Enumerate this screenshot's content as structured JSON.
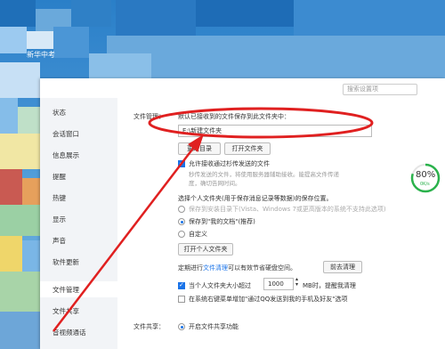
{
  "desktop": {
    "label": "新华中考"
  },
  "window": {
    "search_placeholder": "搜索设置项"
  },
  "sidebar": {
    "items": [
      {
        "label": "状态"
      },
      {
        "label": "会话窗口"
      },
      {
        "label": "信息展示"
      },
      {
        "label": "提醒"
      },
      {
        "label": "热键"
      },
      {
        "label": "显示"
      },
      {
        "label": "声音"
      },
      {
        "label": "软件更新"
      },
      {
        "label": "文件管理"
      },
      {
        "label": "文件共享"
      },
      {
        "label": "音视频通话"
      }
    ],
    "selected": "文件管理"
  },
  "file_mgmt": {
    "section_label": "文件管理：",
    "intro": "默认已接收到的文件保存到此文件夹中：",
    "path_value": "E:\\新建文件夹",
    "change_dir_btn": "更改目录",
    "open_folder_btn": "打开文件夹",
    "allow_virus_label": "允许接收通过杉传发送的文件",
    "virus_desc_1": "秒传发送的文件，将使用服务器辅助接收。能提高文件传递",
    "virus_desc_2": "度，确切告网时间。",
    "personal_folder_title": "选择个人文件夹(用于保存消息记录等数据)的保存位置。",
    "opt_install_dir": "保存到安装目录下(Vista、Windows 7或更高版本的系统不支持此选项)",
    "opt_my_docs": "保存到\"我的文档\"(推荐)",
    "opt_custom": "自定义",
    "open_personal_btn": "打开个人文件夹",
    "cleanup_prefix": "定期进行",
    "cleanup_link": "文件清理",
    "cleanup_suffix": "可以有效节省硬盘空间。",
    "cleanup_btn": "前去清理",
    "size_check_prefix": "当个人文件夹大小超过",
    "size_value": "1000",
    "size_check_suffix": "MB时，提醒我清理",
    "context_menu_label": "在系统右键菜单增加\"通过QQ发送到我的手机及好友\"选项"
  },
  "file_share": {
    "section_label": "文件共享：",
    "enable_label": "开启文件共享功能"
  },
  "gauge": {
    "percent": "80%",
    "speed": "0K/s",
    "value": 0.8,
    "color": "#2bb24c"
  },
  "annotation_color": "#e02020"
}
